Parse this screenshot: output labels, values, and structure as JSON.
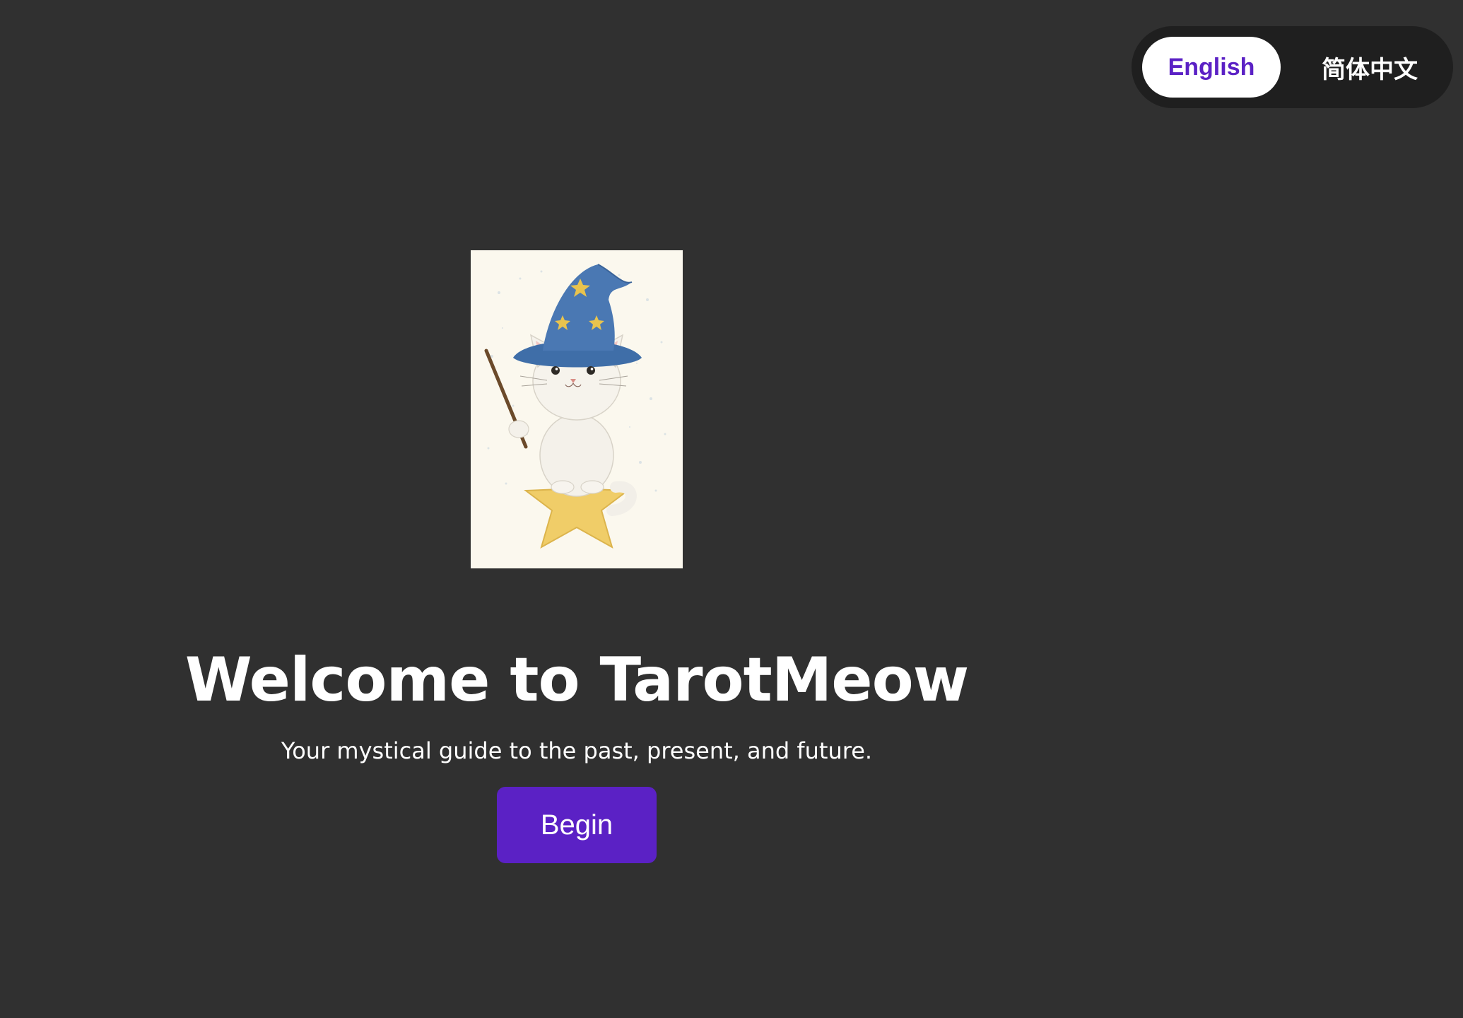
{
  "language_switcher": {
    "options": [
      {
        "label": "English",
        "selected": true
      },
      {
        "label": "简体中文",
        "selected": false
      }
    ]
  },
  "hero": {
    "image": {
      "icon": "wizard-cat-card-illustration"
    },
    "title": "Welcome to TarotMeow",
    "subtitle": "Your mystical guide to the past, present, and future.",
    "begin_label": "Begin"
  },
  "colors": {
    "background": "#303030",
    "switcher_bg": "#1f1f1f",
    "accent": "#5b21c5",
    "text": "#ffffff"
  }
}
